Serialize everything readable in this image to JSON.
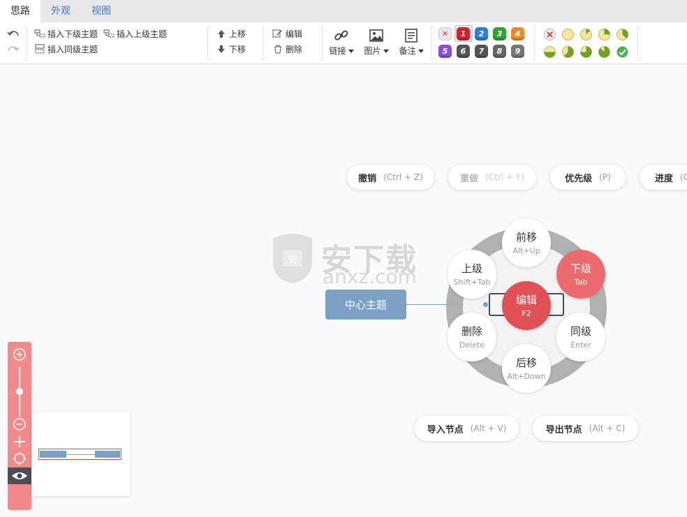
{
  "tabs": [
    {
      "label": "思路",
      "active": true
    },
    {
      "label": "外观",
      "active": false
    },
    {
      "label": "视图",
      "active": false
    }
  ],
  "toolbar": {
    "insert_child": "插入下级主题",
    "insert_parent": "插入上级主题",
    "insert_sibling": "插入同级主题",
    "move_up": "上移",
    "move_down": "下移",
    "edit": "编辑",
    "delete": "删除",
    "link": "链接",
    "image": "图片",
    "note": "备注",
    "priorities": [
      "1",
      "2",
      "3",
      "4",
      "5",
      "6",
      "7",
      "8",
      "9"
    ],
    "priority_colors": [
      "#d91f25",
      "#2f7fd6",
      "#2aa535",
      "#f08a24",
      "#8a4fd8",
      "#555555",
      "#555555",
      "#666666",
      "#777777"
    ]
  },
  "quick_actions": {
    "undo": {
      "label": "撤销",
      "shortcut": "(Ctrl + Z)"
    },
    "redo": {
      "label": "重做",
      "shortcut": "(Ctrl + Y)"
    },
    "priority": {
      "label": "优先级",
      "shortcut": "(P)"
    },
    "progress": {
      "label": "进度",
      "shortcut": "(G)"
    },
    "import_node": {
      "label": "导入节点",
      "shortcut": "(Alt + V)"
    },
    "export_node": {
      "label": "导出节点",
      "shortcut": "(Alt + C)"
    }
  },
  "radial_menu": {
    "front": {
      "label": "前移",
      "key": "Alt+Up"
    },
    "parent": {
      "label": "上级",
      "key": "Shift+Tab"
    },
    "child": {
      "label": "下级",
      "key": "Tab"
    },
    "edit": {
      "label": "编辑",
      "key": "F2"
    },
    "delete": {
      "label": "删除",
      "key": "Delete"
    },
    "sibling": {
      "label": "同级",
      "key": "Enter"
    },
    "back": {
      "label": "后移",
      "key": "Alt+Down"
    }
  },
  "center_topic": "中心主题",
  "watermark": {
    "text": "安下载",
    "sub": "anxz.com"
  }
}
